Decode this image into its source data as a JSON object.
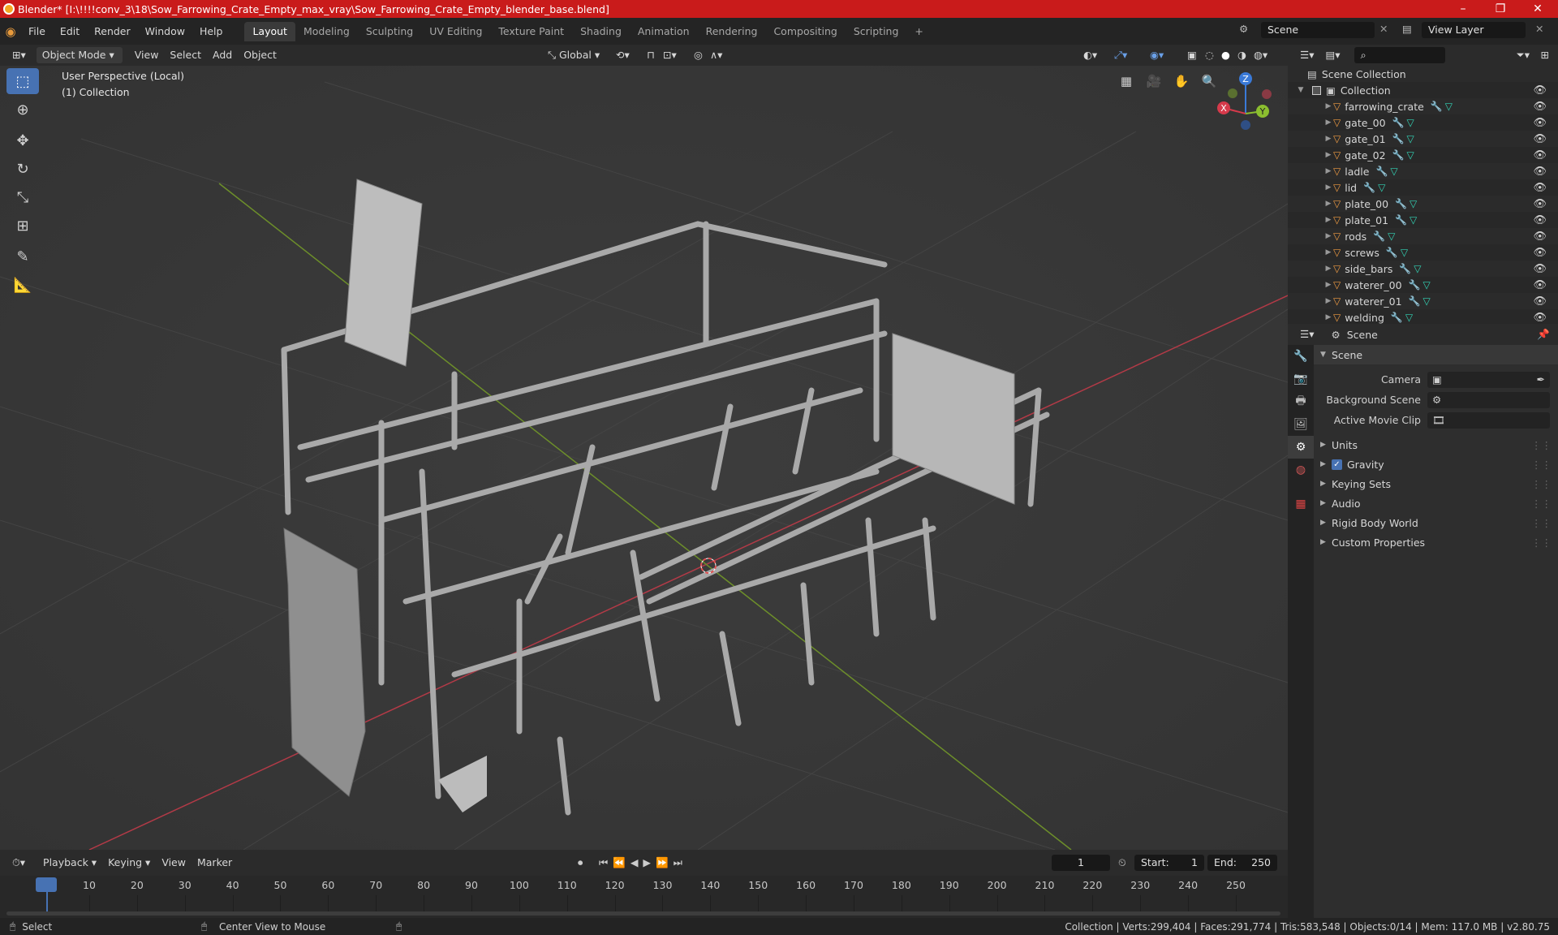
{
  "window": {
    "title": "Blender* [I:\\!!!!conv_3\\18\\Sow_Farrowing_Crate_Empty_max_vray\\Sow_Farrowing_Crate_Empty_blender_base.blend]",
    "controls": [
      "–",
      "❐",
      "✕"
    ]
  },
  "menubar": {
    "menus": [
      "File",
      "Edit",
      "Render",
      "Window",
      "Help"
    ],
    "workspaces": [
      "Layout",
      "Modeling",
      "Sculpting",
      "UV Editing",
      "Texture Paint",
      "Shading",
      "Animation",
      "Rendering",
      "Compositing",
      "Scripting"
    ],
    "active_workspace": "Layout",
    "add_tab": "+",
    "scene_label": "Scene",
    "view_layer_label": "View Layer"
  },
  "viewport_header": {
    "mode": "Object Mode",
    "menus": [
      "View",
      "Select",
      "Add",
      "Object"
    ],
    "transform": "Global"
  },
  "viewport": {
    "perspective": "User Perspective (Local)",
    "collection": "(1) Collection",
    "gizmo": {
      "x": "X",
      "y": "Y",
      "z": "Z"
    },
    "colors": {
      "x_axis": "#d63a4b",
      "y_axis": "#8bbe2f",
      "background": "#393939"
    }
  },
  "outliner": {
    "search_placeholder": "",
    "root": "Scene Collection",
    "collection": "Collection",
    "objects": [
      "farrowing_crate",
      "gate_00",
      "gate_01",
      "gate_02",
      "ladle",
      "lid",
      "plate_00",
      "plate_01",
      "rods",
      "screws",
      "side_bars",
      "waterer_00",
      "waterer_01",
      "welding"
    ]
  },
  "properties": {
    "context": "Scene",
    "section": "Scene",
    "fields": [
      {
        "label": "Camera",
        "value": ""
      },
      {
        "label": "Background Scene",
        "value": ""
      },
      {
        "label": "Active Movie Clip",
        "value": ""
      }
    ],
    "panels": [
      {
        "label": "Units",
        "checkbox": false
      },
      {
        "label": "Gravity",
        "checkbox": true
      },
      {
        "label": "Keying Sets",
        "checkbox": false
      },
      {
        "label": "Audio",
        "checkbox": false
      },
      {
        "label": "Rigid Body World",
        "checkbox": false
      },
      {
        "label": "Custom Properties",
        "checkbox": false
      }
    ]
  },
  "timeline": {
    "menus": [
      "Playback",
      "Keying",
      "View",
      "Marker"
    ],
    "current_frame": "1",
    "start_label": "Start:",
    "start": "1",
    "end_label": "End:",
    "end": "250",
    "ticks": [
      "1",
      "10",
      "20",
      "30",
      "40",
      "50",
      "60",
      "70",
      "80",
      "90",
      "100",
      "110",
      "120",
      "130",
      "140",
      "150",
      "160",
      "170",
      "180",
      "190",
      "200",
      "210",
      "220",
      "230",
      "240",
      "250"
    ]
  },
  "statusbar": {
    "select": "Select",
    "center": "Center View to Mouse",
    "stats": "Collection | Verts:299,404 | Faces:291,774 | Tris:583,548 | Objects:0/14 | Mem: 117.0 MB | v2.80.75"
  }
}
